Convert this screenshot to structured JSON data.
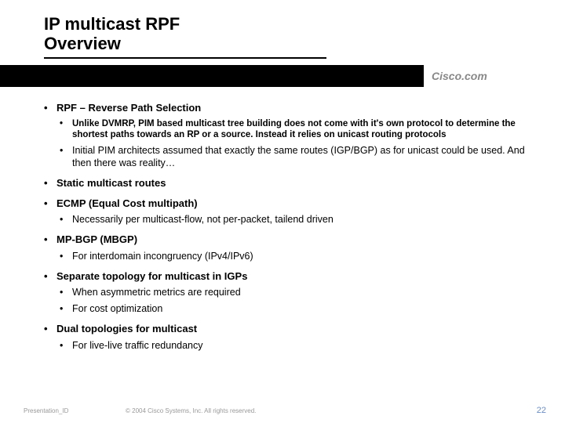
{
  "title": {
    "line1": "IP multicast RPF",
    "line2": "Overview"
  },
  "brand": "Cisco.com",
  "bullets": {
    "b1": "RPF – Reverse Path Selection",
    "b1_1": "Unlike DVMRP, PIM based multicast tree building does not come with it's own protocol to determine the shortest paths towards an RP or a source. Instead it relies on unicast routing protocols",
    "b1_2": "Initial PIM architects assumed that exactly the same routes (IGP/BGP) as for unicast could be used. And then there was reality…",
    "b2": "Static multicast routes",
    "b3": "ECMP (Equal Cost multipath)",
    "b3_1": "Necessarily per multicast-flow, not per-packet, tailend driven",
    "b4": "MP-BGP (MBGP)",
    "b4_1": "For interdomain incongruency (IPv4/IPv6)",
    "b5": "Separate topology for multicast in IGPs",
    "b5_1": "When asymmetric metrics are required",
    "b5_2": "For cost optimization",
    "b6": "Dual topologies for multicast",
    "b6_1": "For live-live traffic redundancy"
  },
  "footer": {
    "left": "Presentation_ID",
    "center": "© 2004 Cisco Systems, Inc. All rights reserved.",
    "right": "22"
  }
}
